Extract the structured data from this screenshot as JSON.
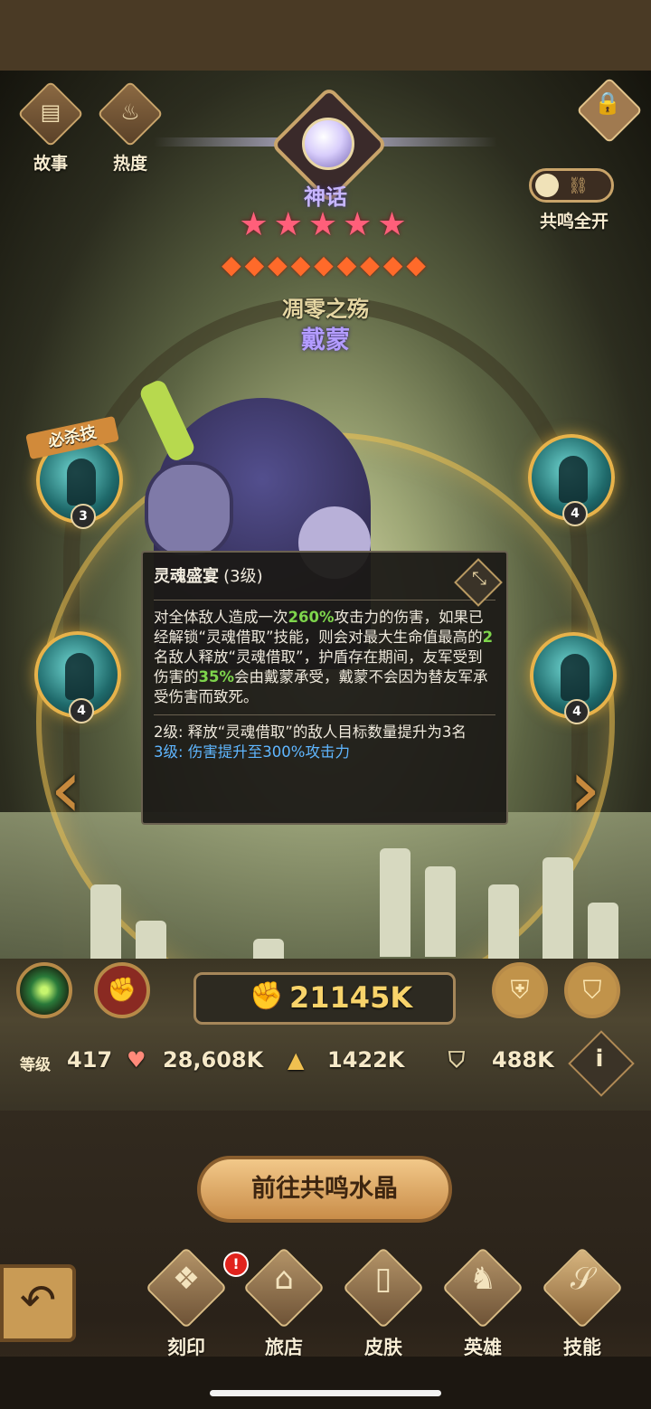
{
  "top_buttons": {
    "story": {
      "label": "故事",
      "icon": "book-icon"
    },
    "popularity": {
      "label": "热度",
      "icon": "flame-icon"
    },
    "lock": {
      "icon": "lock-icon"
    }
  },
  "hero": {
    "rarity": "神话",
    "stars": 5,
    "stars_text": "★★★★★",
    "ascension_gems": 9,
    "gems_text": "◆◆◆◆◆◆◆◆◆",
    "faction": "凋零之殇",
    "name": "戴蒙"
  },
  "resonance": {
    "label": "共鸣全开"
  },
  "skills": {
    "ultimate_tag": "必杀技",
    "left_top_level": "3",
    "left_bottom_level": "4",
    "right_top_level": "4",
    "right_bottom_level": "4"
  },
  "tooltip": {
    "title": "灵魂盛宴",
    "level_text": "(3级)",
    "desc_a": "对全体敌人造成一次",
    "desc_pct1": "260%",
    "desc_b": "攻击力的伤害，如果已经解锁“灵魂借取”技能，则会对最大生命值最高的",
    "desc_num": "2",
    "desc_c": "名敌人释放“灵魂借取”，护盾存在期间，友军受到伤害的",
    "desc_pct2": "35%",
    "desc_d": "会由戴蒙承受，戴蒙不会因为替友军承受伤害而致死。",
    "level2": "2级: 释放“灵魂借取”的敌人目标数量提升为3名",
    "level3": "3级: 伤害提升至300%攻击力"
  },
  "power": {
    "value": "21145K"
  },
  "stats": {
    "level_label": "等级",
    "level": "417",
    "hp": "28,608K",
    "attack": "1422K",
    "defense": "488K"
  },
  "goto_button": "前往共鸣水晶",
  "nav": [
    {
      "label": "刻印",
      "icon": "rune-icon",
      "alert": "!"
    },
    {
      "label": "旅店",
      "icon": "inn-icon"
    },
    {
      "label": "皮肤",
      "icon": "wardrobe-icon"
    },
    {
      "label": "英雄",
      "icon": "knight-icon"
    },
    {
      "label": "技能",
      "icon": "skill-scroll-icon"
    }
  ],
  "colors": {
    "accent": "#c9a46a",
    "highlight_green": "#7ed54c",
    "highlight_blue": "#5fb6ff",
    "rarity_purple": "#b39cff"
  }
}
